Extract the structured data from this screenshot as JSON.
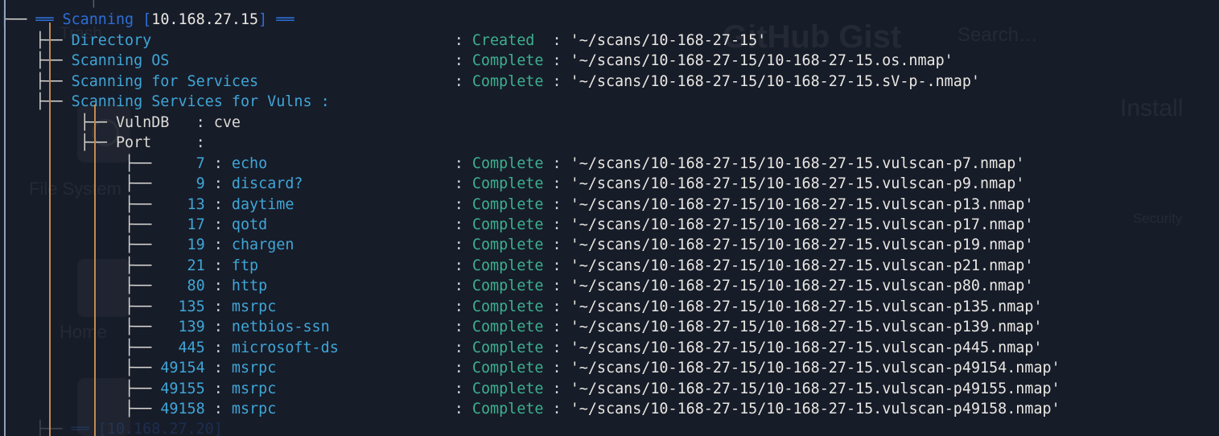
{
  "terminal": {
    "header": {
      "bullet": "├──",
      "eq_left": "══",
      "title": "Scanning",
      "bracket_open": "[",
      "host": "10.168.27.15",
      "bracket_close": "]",
      "eq_right": "══"
    },
    "branch_glyph": "├──",
    "pipe_glyph": "│",
    "colon": ":",
    "quote": "'",
    "top_partial_row": "│         │",
    "bottom_partial_row": "[10.168.27.20]",
    "tasks": [
      {
        "name": "Directory",
        "status": "Created",
        "path": "'~/scans/10-168-27-15'"
      },
      {
        "name": "Scanning OS",
        "status": "Complete",
        "path": "'~/scans/10-168-27-15/10-168-27-15.os.nmap'"
      },
      {
        "name": "Scanning for Services",
        "status": "Complete",
        "path": "'~/scans/10-168-27-15/10-168-27-15.sV-p-.nmap'"
      },
      {
        "name": "Scanning Services for Vulns :",
        "status": "",
        "path": ""
      }
    ],
    "vuln_params": [
      {
        "key": "VulnDB",
        "value": "cve"
      },
      {
        "key": "Port",
        "value": ""
      }
    ],
    "ports_header": "Port",
    "ports": [
      {
        "port": "7",
        "service": "echo",
        "status": "Complete",
        "path": "'~/scans/10-168-27-15/10-168-27-15.vulscan-p7.nmap'"
      },
      {
        "port": "9",
        "service": "discard?",
        "status": "Complete",
        "path": "'~/scans/10-168-27-15/10-168-27-15.vulscan-p9.nmap'"
      },
      {
        "port": "13",
        "service": "daytime",
        "status": "Complete",
        "path": "'~/scans/10-168-27-15/10-168-27-15.vulscan-p13.nmap'"
      },
      {
        "port": "17",
        "service": "qotd",
        "status": "Complete",
        "path": "'~/scans/10-168-27-15/10-168-27-15.vulscan-p17.nmap'"
      },
      {
        "port": "19",
        "service": "chargen",
        "status": "Complete",
        "path": "'~/scans/10-168-27-15/10-168-27-15.vulscan-p19.nmap'"
      },
      {
        "port": "21",
        "service": "ftp",
        "status": "Complete",
        "path": "'~/scans/10-168-27-15/10-168-27-15.vulscan-p21.nmap'"
      },
      {
        "port": "80",
        "service": "http",
        "status": "Complete",
        "path": "'~/scans/10-168-27-15/10-168-27-15.vulscan-p80.nmap'"
      },
      {
        "port": "135",
        "service": "msrpc",
        "status": "Complete",
        "path": "'~/scans/10-168-27-15/10-168-27-15.vulscan-p135.nmap'"
      },
      {
        "port": "139",
        "service": "netbios-ssn",
        "status": "Complete",
        "path": "'~/scans/10-168-27-15/10-168-27-15.vulscan-p139.nmap'"
      },
      {
        "port": "445",
        "service": "microsoft-ds",
        "status": "Complete",
        "path": "'~/scans/10-168-27-15/10-168-27-15.vulscan-p445.nmap'"
      },
      {
        "port": "49154",
        "service": "msrpc",
        "status": "Complete",
        "path": "'~/scans/10-168-27-15/10-168-27-15.vulscan-p49154.nmap'"
      },
      {
        "port": "49155",
        "service": "msrpc",
        "status": "Complete",
        "path": "'~/scans/10-168-27-15/10-168-27-15.vulscan-p49155.nmap'"
      },
      {
        "port": "49158",
        "service": "msrpc",
        "status": "Complete",
        "path": "'~/scans/10-168-27-15/10-168-27-15.vulscan-p49158.nmap'"
      }
    ]
  },
  "backdrop": {
    "watermarks": [
      "Trash",
      "File System",
      "Home",
      "GitHub Gist",
      "Search…",
      "Install",
      "Security"
    ]
  },
  "colors": {
    "background": "#171c29",
    "label_cyan": "#3fa6d6",
    "status_green": "#3cb08d",
    "path_white": "#e9e7e2",
    "header_blue": "#2c6fd6",
    "tree_gray": "#d9d7d2"
  }
}
